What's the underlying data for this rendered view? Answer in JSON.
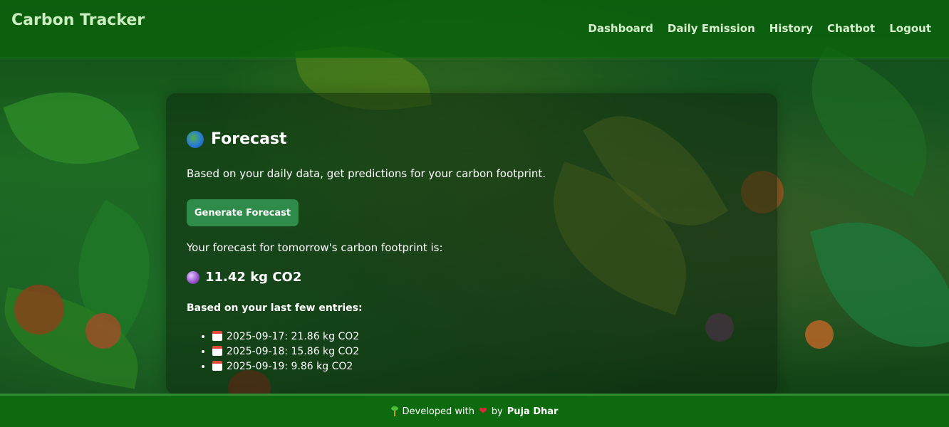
{
  "app": {
    "brand": "Carbon Tracker"
  },
  "nav": {
    "items": [
      {
        "label": "Dashboard"
      },
      {
        "label": "Daily Emission"
      },
      {
        "label": "History"
      },
      {
        "label": "Chatbot"
      },
      {
        "label": "Logout"
      }
    ]
  },
  "forecast": {
    "icon": "globe-icon",
    "title": "Forecast",
    "subtitle": "Based on your daily data, get predictions for your carbon footprint.",
    "button_label": "Generate Forecast",
    "result_label": "Your forecast for tomorrow's carbon footprint is:",
    "result_icon": "crystal-ball-icon",
    "result_value": "11.42 kg CO2",
    "entries_heading": "Based on your last few entries:",
    "entries": [
      {
        "icon": "calendar-icon",
        "text": "2025-09-17: 21.86 kg CO2"
      },
      {
        "icon": "calendar-icon",
        "text": "2025-09-18: 15.86 kg CO2"
      },
      {
        "icon": "calendar-icon",
        "text": "2025-09-19: 9.86 kg CO2"
      }
    ]
  },
  "footer": {
    "prefix": "Developed with",
    "heart_icon": "heart-icon",
    "by": "by",
    "author": "Puja Dhar"
  },
  "colors": {
    "navbar": "#0a640a",
    "button": "#2e8b49",
    "footer": "#0e6a0e",
    "brand_text": "#cdeec0"
  }
}
